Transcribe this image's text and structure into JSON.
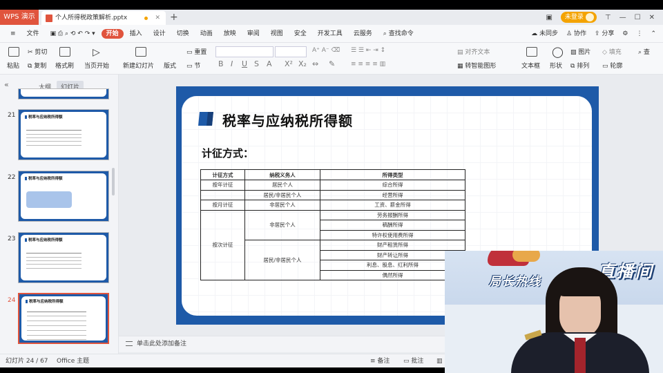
{
  "titlebar": {
    "app_tab": "WPS 演示",
    "doc_tab": "个人所得税政策解析.pptx",
    "login": "未登录"
  },
  "menu": {
    "file": "文件",
    "items": [
      "开始",
      "插入",
      "设计",
      "切换",
      "动画",
      "放映",
      "审阅",
      "视图",
      "安全",
      "开发工具",
      "云服务"
    ],
    "search": "查找命令",
    "sync": "未同步",
    "collab": "协作",
    "share": "分享"
  },
  "ribbon": {
    "paste": "粘贴",
    "cut": "剪切",
    "copy": "复制",
    "format_painter": "格式刷",
    "from_current": "当页开始",
    "new_slide": "新建幻灯片",
    "layout": "版式",
    "section": "节",
    "reset": "重置",
    "align_text": "对齐文本",
    "smart_graphic": "转智能图形",
    "textbox": "文本框",
    "shape": "形状",
    "arrange": "排列",
    "picture": "图片",
    "fill": "填充",
    "outline": "轮廓",
    "find": "查"
  },
  "left_panel": {
    "tab_outline": "大纲",
    "tab_slides": "幻灯片",
    "slides": [
      {
        "num": "21",
        "title": "税率与应纳税所得额"
      },
      {
        "num": "22",
        "title": "税率与应纳税所得额"
      },
      {
        "num": "23",
        "title": "税率与应纳税所得额"
      },
      {
        "num": "24",
        "title": "税率与应纳税所得额"
      }
    ]
  },
  "slide": {
    "title": "税率与应纳税所得额",
    "subtitle": "计征方式：",
    "table": {
      "headers": [
        "计征方式",
        "纳税义务人",
        "所得类型"
      ],
      "rows": [
        [
          "按年计征",
          "居民个人",
          "综合所得"
        ],
        [
          "",
          "居民/非居民个人",
          "经营所得"
        ],
        [
          "按月计征",
          "非居民个人",
          "工资、薪金所得"
        ],
        [
          "按次计征",
          "非居民个人",
          "劳务报酬所得"
        ],
        [
          "",
          "",
          "稿酬所得"
        ],
        [
          "",
          "",
          "特许权使用费所得"
        ],
        [
          "",
          "居民/非居民个人",
          "财产租赁所得"
        ],
        [
          "",
          "",
          "财产转让所得"
        ],
        [
          "",
          "",
          "利息、股息、红利所得"
        ],
        [
          "",
          "",
          "偶然所得"
        ]
      ]
    }
  },
  "notes": {
    "placeholder": "单击此处添加备注"
  },
  "status": {
    "slide_info": "幻灯片 24 / 67",
    "theme": "Office 主题",
    "notes_btn": "备注",
    "comment_btn": "批注"
  },
  "video": {
    "hotline": "局长热线",
    "live": "直播间"
  },
  "colors": {
    "brand": "#e0543d",
    "slide_blue": "#1e5aa8"
  }
}
